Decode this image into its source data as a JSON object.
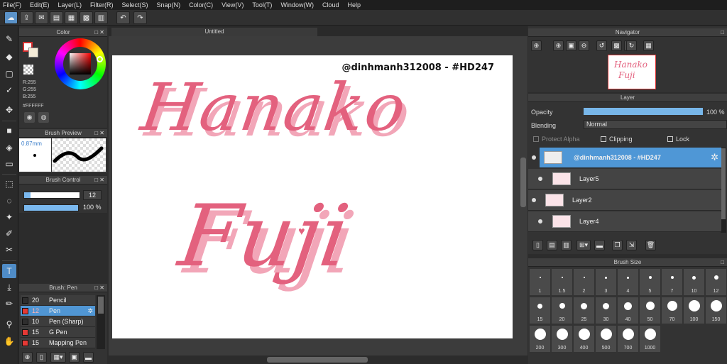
{
  "menu": [
    "File(F)",
    "Edit(E)",
    "Layer(L)",
    "Filter(R)",
    "Select(S)",
    "Snap(N)",
    "Color(C)",
    "View(V)",
    "Tool(T)",
    "Window(W)",
    "Cloud",
    "Help"
  ],
  "color_panel": {
    "title": "Color",
    "r": "R:255",
    "g": "G:255",
    "b": "B:255",
    "hex": "#FFFFFF"
  },
  "brush_preview": {
    "title": "Brush Preview",
    "size": "0.87mm"
  },
  "brush_control": {
    "title": "Brush Control",
    "size": "12",
    "opacity": "100 %",
    "size_fraction": 0.12,
    "opacity_fraction": 1.0
  },
  "brush_list": {
    "title": "Brush: Pen",
    "items": [
      {
        "size": "20",
        "name": "Pencil",
        "color": "#2e2e2e"
      },
      {
        "size": "12",
        "name": "Pen",
        "color": "#e53935",
        "selected": true
      },
      {
        "size": "10",
        "name": "Pen (Sharp)",
        "color": "#2e2e2e"
      },
      {
        "size": "15",
        "name": "G Pen",
        "color": "#e53935"
      },
      {
        "size": "15",
        "name": "Mapping Pen",
        "color": "#e53935"
      }
    ]
  },
  "document": {
    "tab": "Untitled",
    "watermark": "@dinhmanh312008 - #HD247",
    "line1": "Hanako",
    "line2": "Fuji"
  },
  "navigator": {
    "title": "Navigator"
  },
  "layer_panel": {
    "title": "Layer",
    "opacity_label": "Opacity",
    "opacity_value": "100 %",
    "opacity_fraction": 1.0,
    "blending_label": "Blending",
    "blending_value": "Normal",
    "protect_alpha": "Protect Alpha",
    "clipping": "Clipping",
    "lock": "Lock"
  },
  "layers": [
    {
      "name": "@dinhmanh312008 - #HD247",
      "selected": true
    },
    {
      "name": "Layer5"
    },
    {
      "name": "Layer2"
    },
    {
      "name": "Layer4"
    }
  ],
  "brush_size": {
    "title": "Brush Size",
    "sizes": [
      "1",
      "1.5",
      "2",
      "3",
      "4",
      "5",
      "7",
      "10",
      "12",
      "15",
      "20",
      "25",
      "30",
      "40",
      "50",
      "70",
      "100",
      "150",
      "200",
      "300",
      "400",
      "500",
      "700",
      "1000"
    ]
  }
}
